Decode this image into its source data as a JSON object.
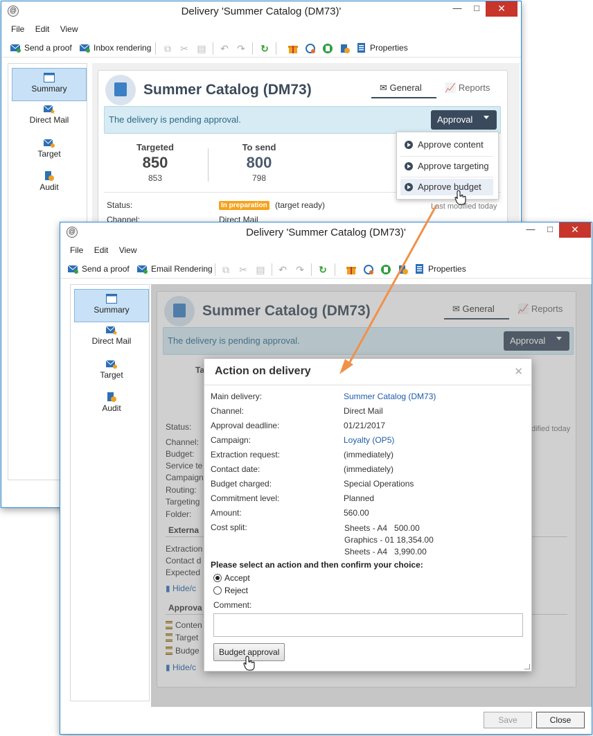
{
  "window1": {
    "title": "Delivery 'Summer Catalog  (DM73)'",
    "menu": [
      "File",
      "Edit",
      "View"
    ],
    "toolbar": {
      "send_proof": "Send a proof",
      "rendering": "Inbox rendering",
      "properties": "Properties"
    },
    "nav": [
      "Summary",
      "Direct Mail",
      "Target",
      "Audit"
    ],
    "header": {
      "title": "Summer Catalog (DM73)",
      "tab_general": "General",
      "tab_reports": "Reports"
    },
    "pending": "The delivery is pending approval.",
    "approval_button": "Approval",
    "dropdown": [
      "Approve content",
      "Approve targeting",
      "Approve budget"
    ],
    "stats": {
      "targeted_label": "Targeted",
      "targeted_big": "850",
      "targeted_small": "853",
      "tosend_label": "To send",
      "tosend_big": "800",
      "tosend_small": "798"
    },
    "status_label": "Status:",
    "status_badge": "In preparation",
    "status_text": "(target ready)",
    "channel_label": "Channel:",
    "channel_value": "Direct Mail",
    "last_modified": "Last modified today"
  },
  "window2": {
    "title": "Delivery 'Summer Catalog  (DM73)'",
    "menu": [
      "File",
      "Edit",
      "View"
    ],
    "toolbar": {
      "send_proof": "Send a proof",
      "rendering": "Email Rendering",
      "properties": "Properties"
    },
    "nav": [
      "Summary",
      "Direct Mail",
      "Target",
      "Audit"
    ],
    "header": {
      "title": "Summer Catalog (DM73)",
      "tab_general": "General",
      "tab_reports": "Reports"
    },
    "pending": "The delivery is pending approval.",
    "approval_button": "Approval",
    "bg_targeted_fragment": "Ta",
    "last_modified_fragment": "dified today",
    "bg_labels": [
      "Status:",
      "Channel:",
      "Budget:",
      "Service te",
      "Campaign",
      "Routing:",
      "Targeting",
      "Folder:"
    ],
    "external_section": "Externa",
    "external_labels": [
      "Extraction",
      "Contact d",
      "Expected"
    ],
    "hide_link": "Hide/c",
    "approval_section": "Approva",
    "approval_items": [
      "Conten",
      "Target",
      "Budge"
    ],
    "hide_link2": "Hide/c",
    "save_button": "Save",
    "close_button": "Close"
  },
  "dialog": {
    "title": "Action on delivery",
    "rows": [
      {
        "label": "Main delivery:",
        "value": "Summer Catalog (DM73)",
        "link": true
      },
      {
        "label": "Channel:",
        "value": "Direct Mail",
        "link": false
      },
      {
        "label": "Approval deadline:",
        "value": "01/21/2017",
        "link": false
      },
      {
        "label": "Campaign:",
        "value": "Loyalty (OP5)",
        "link": true
      },
      {
        "label": "Extraction request:",
        "value": "(immediately)",
        "link": false
      },
      {
        "label": "Contact date:",
        "value": "(immediately)",
        "link": false
      },
      {
        "label": "Budget charged:",
        "value": "Special Operations",
        "link": false
      },
      {
        "label": "Commitment level:",
        "value": "Planned",
        "link": false
      },
      {
        "label": "Amount:",
        "value": "560.00",
        "link": false
      },
      {
        "label": "Cost split:",
        "value": "",
        "link": false
      }
    ],
    "cost_split": [
      "Sheets - A4   500.00",
      "Graphics - 01 18,354.00",
      "Sheets - A4   3,990.00"
    ],
    "prompt": "Please select an action and then confirm your choice:",
    "accept": "Accept",
    "reject": "Reject",
    "selected": "Accept",
    "comment_label": "Comment:",
    "comment_value": "",
    "confirm_button": "Budget approval"
  },
  "colors": {
    "accent": "#3a4a5c",
    "frame": "#2a8cd8",
    "pending_bg": "#d6ebf3",
    "arrow": "#f0914a",
    "badge": "#f5a21b",
    "link": "#1f5ca8"
  },
  "icons": [
    "app-icon",
    "send-proof-icon",
    "rendering-icon",
    "copy-icon",
    "cut-icon",
    "paste-icon",
    "undo-icon",
    "redo-icon",
    "refresh-icon",
    "gift-icon",
    "target-icon",
    "calculator-icon",
    "audit-icon",
    "properties-icon",
    "summary-icon",
    "direct-mail-icon",
    "target-nav-icon",
    "audit-nav-icon",
    "delivery-logo-icon",
    "envelope-icon",
    "chart-icon",
    "hourglass-icon",
    "hand-cursor-icon"
  ]
}
